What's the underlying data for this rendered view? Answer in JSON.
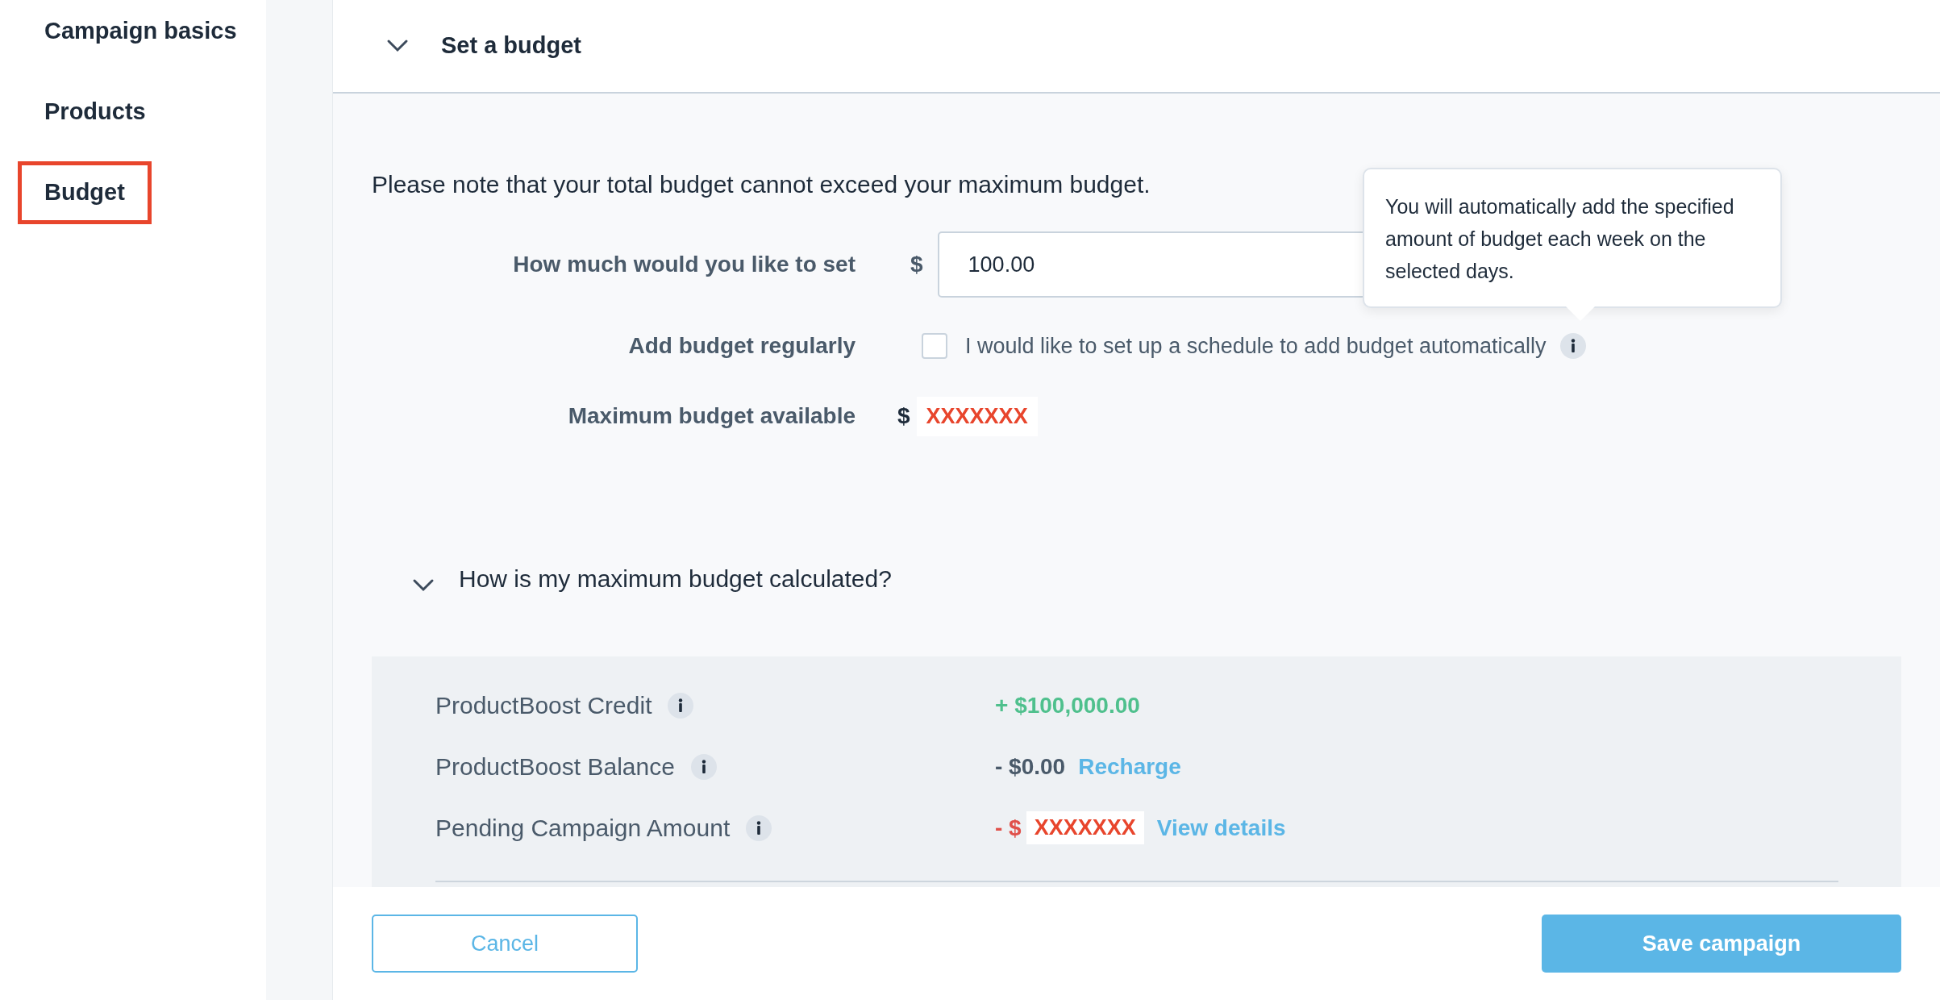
{
  "sidebar": {
    "items": [
      {
        "label": "Campaign basics",
        "selected": false
      },
      {
        "label": "Products",
        "selected": false
      },
      {
        "label": "Budget",
        "selected": true
      }
    ]
  },
  "section": {
    "title": "Set a budget",
    "expanded": true
  },
  "note": "Please note that your total budget cannot exceed your maximum budget.",
  "form": {
    "amount": {
      "label": "How much would you like to set",
      "currency": "$",
      "value": "100.00"
    },
    "schedule": {
      "label": "Add budget regularly",
      "checked": false,
      "text": "I would like to set up a schedule to add budget automatically"
    },
    "maximum": {
      "label": "Maximum budget available",
      "currency": "$",
      "value": "XXXXXXX"
    }
  },
  "tooltip": {
    "text": "You will automatically add the specified amount of budget each week on the selected days."
  },
  "faq": {
    "question": "How is my maximum budget calculated?",
    "expanded": true
  },
  "breakdown": [
    {
      "label": "ProductBoost Credit",
      "kind": "positive",
      "amount": "+ $100,000.00"
    },
    {
      "label": "ProductBoost Balance",
      "kind": "neutral",
      "amount": "- $0.00",
      "link": "Recharge"
    },
    {
      "label": "Pending Campaign Amount",
      "kind": "negative",
      "amount": "- $",
      "redacted": "XXXXXXX",
      "link": "View details"
    }
  ],
  "footer": {
    "cancel": "Cancel",
    "save": "Save campaign"
  }
}
